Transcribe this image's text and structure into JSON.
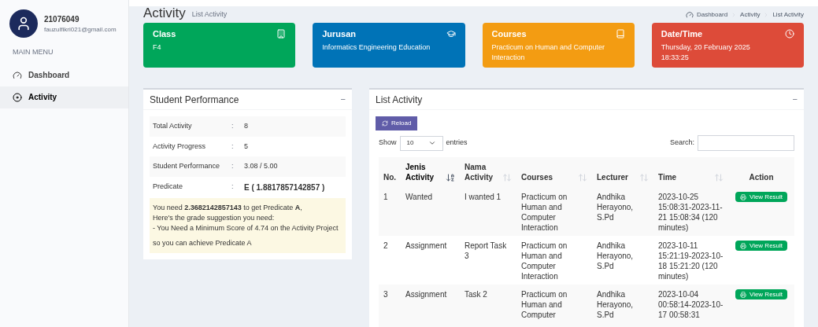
{
  "user": {
    "id": "21076049",
    "email": "fauzulfikri021@gmail.com"
  },
  "sidebar": {
    "heading": "MAIN MENU",
    "items": [
      {
        "label": "Dashboard",
        "kind": "gauge",
        "selected": false
      },
      {
        "label": "Activity",
        "kind": "disc",
        "selected": true
      }
    ]
  },
  "page": {
    "title": "Activity",
    "subtitle": "List Activity"
  },
  "breadcrumb": [
    "Dashboard",
    "Activity",
    "List Activity"
  ],
  "cards": [
    {
      "title": "Class",
      "value": "F4",
      "kind": "class",
      "color": "#00a65a"
    },
    {
      "title": "Jurusan",
      "value": "Informatics Engineering Education",
      "kind": "major",
      "color": "#0073b7"
    },
    {
      "title": "Courses",
      "value": "Practicum on Human and Computer Interaction",
      "kind": "course",
      "color": "#f39c12"
    },
    {
      "title": "Date/Time",
      "value": "Thursday, 20 February 2025 18:33:25",
      "kind": "time",
      "color": "#dd4b39"
    }
  ],
  "performance": {
    "title": "Student Performance",
    "collapse": "−",
    "rows": [
      {
        "label": "Total Activity",
        "sep": ":",
        "value": "8",
        "bold": false
      },
      {
        "label": "Activity Progress",
        "sep": ":",
        "value": "5",
        "bold": false
      },
      {
        "label": "Student Performance",
        "sep": ":",
        "value": "3.08 / 5.00",
        "bold": false
      },
      {
        "label": "Predicate",
        "sep": ":",
        "value": "E ( 1.8817857142857 )",
        "bold": true
      }
    ],
    "suggestion": [
      "You need **2.3682142857143** to get Predicate **A**,",
      "Here's the grade suggestion you need:",
      "- You Need a Minimum Score of 4.74 on the Activity Project"
    ],
    "closing": "so you can achieve Predicate A"
  },
  "list": {
    "title": "List Activity",
    "collapse": "−",
    "reload": "Reload",
    "show_label": "Show",
    "page_size": "10",
    "entries_label": "entries",
    "search_label": "Search:",
    "columns": [
      {
        "label": "No.",
        "sortable": false,
        "sorted": false
      },
      {
        "label": "Jenis Activity",
        "sortable": true,
        "sorted": true
      },
      {
        "label": "Nama Activity",
        "sortable": true,
        "sorted": false
      },
      {
        "label": "Courses",
        "sortable": true,
        "sorted": false
      },
      {
        "label": "Lecturer",
        "sortable": true,
        "sorted": false
      },
      {
        "label": "Time",
        "sortable": true,
        "sorted": false
      },
      {
        "label": "Action",
        "sortable": false,
        "sorted": false
      }
    ],
    "rows": [
      {
        "cells": [
          "1",
          "Wanted",
          "I wanted 1",
          "Practicum on Human and Computer Interaction",
          "Andhika Herayono, S.Pd",
          "2023-10-25 15:08:31-2023-11-21 15:08:34 (120 minutes)"
        ],
        "action": "View Result"
      },
      {
        "cells": [
          "2",
          "Assignment",
          "Report Task 3",
          "Practicum on Human and Computer Interaction",
          "Andhika Herayono, S.Pd",
          "2023-10-11 15:21:19-2023-10-18 15:21:20 (120 minutes)"
        ],
        "action": "View Result"
      },
      {
        "cells": [
          "3",
          "Assignment",
          "Task 2",
          "Practicum on Human and Computer",
          "Andhika Herayono, S.Pd",
          "2023-10-04 00:58:14-2023-10-17 00:58:31"
        ],
        "action": "View Result"
      }
    ]
  }
}
